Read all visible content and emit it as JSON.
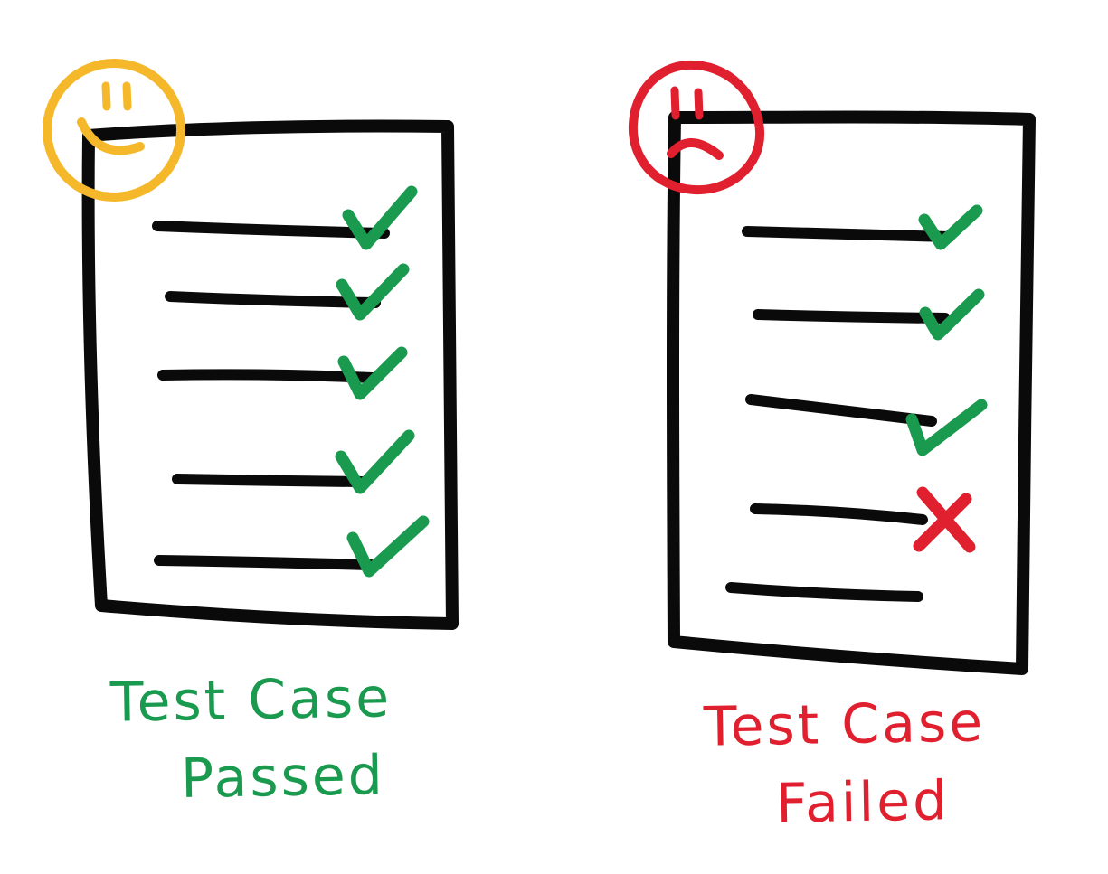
{
  "colors": {
    "ink": "#0a0a0a",
    "pass": "#1a9a4f",
    "fail": "#e0202e",
    "happy": "#f5b82a"
  },
  "passed_card": {
    "face": "smiley-face",
    "items": [
      {
        "status": "pass"
      },
      {
        "status": "pass"
      },
      {
        "status": "pass"
      },
      {
        "status": "pass"
      },
      {
        "status": "pass"
      }
    ],
    "caption_line1": "Test Case",
    "caption_line2": "Passed"
  },
  "failed_card": {
    "face": "frowning-face",
    "items": [
      {
        "status": "pass"
      },
      {
        "status": "pass"
      },
      {
        "status": "pass"
      },
      {
        "status": "fail"
      },
      {
        "status": "none"
      }
    ],
    "caption_line1": "Test Case",
    "caption_line2": "Failed"
  }
}
